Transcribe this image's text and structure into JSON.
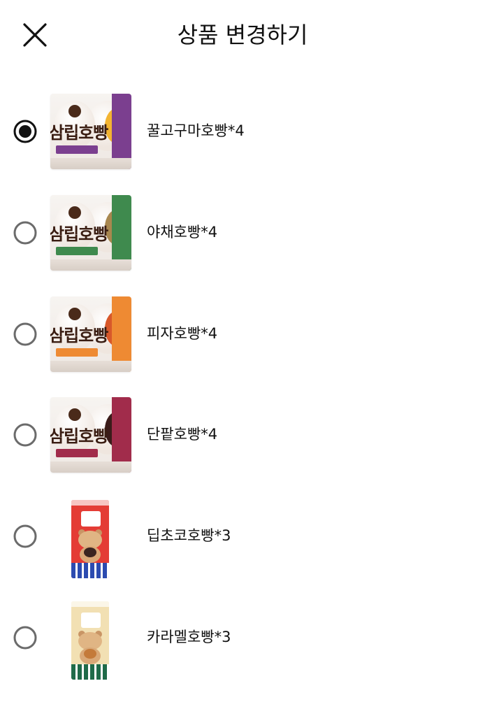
{
  "header": {
    "title": "상품 변경하기",
    "close_icon": "close-icon"
  },
  "items": [
    {
      "label": "꿀고구마호빵*4",
      "selected": true,
      "image": "box",
      "brand": "삼립호빵",
      "accent": "#7b3f8f",
      "filling": "#f3b431",
      "tag": "#7b3f8f"
    },
    {
      "label": "야채호빵*4",
      "selected": false,
      "image": "box",
      "brand": "삼립호빵",
      "accent": "#3f8a4e",
      "filling": "#a8874f",
      "tag": "#3f8a4e"
    },
    {
      "label": "피자호빵*4",
      "selected": false,
      "image": "box",
      "brand": "삼립호빵",
      "accent": "#ee8a33",
      "filling": "#d8582a",
      "tag": "#ee8a33"
    },
    {
      "label": "단팥호빵*4",
      "selected": false,
      "image": "box",
      "brand": "삼립호빵",
      "accent": "#a12c4b",
      "filling": "#3b1c1a",
      "tag": "#a12c4b"
    },
    {
      "label": "딥초코호빵*3",
      "selected": false,
      "image": "bag",
      "bag_color": "#e43c35",
      "bag_head": "#ffffff",
      "bun": "#3a2520",
      "check": "#2c4bb0"
    },
    {
      "label": "카라멜호빵*3",
      "selected": false,
      "image": "bag",
      "bag_color": "#f2e0b3",
      "bag_head": "#ffffff",
      "bun": "#c47a3a",
      "check": "#1f6b49"
    }
  ]
}
